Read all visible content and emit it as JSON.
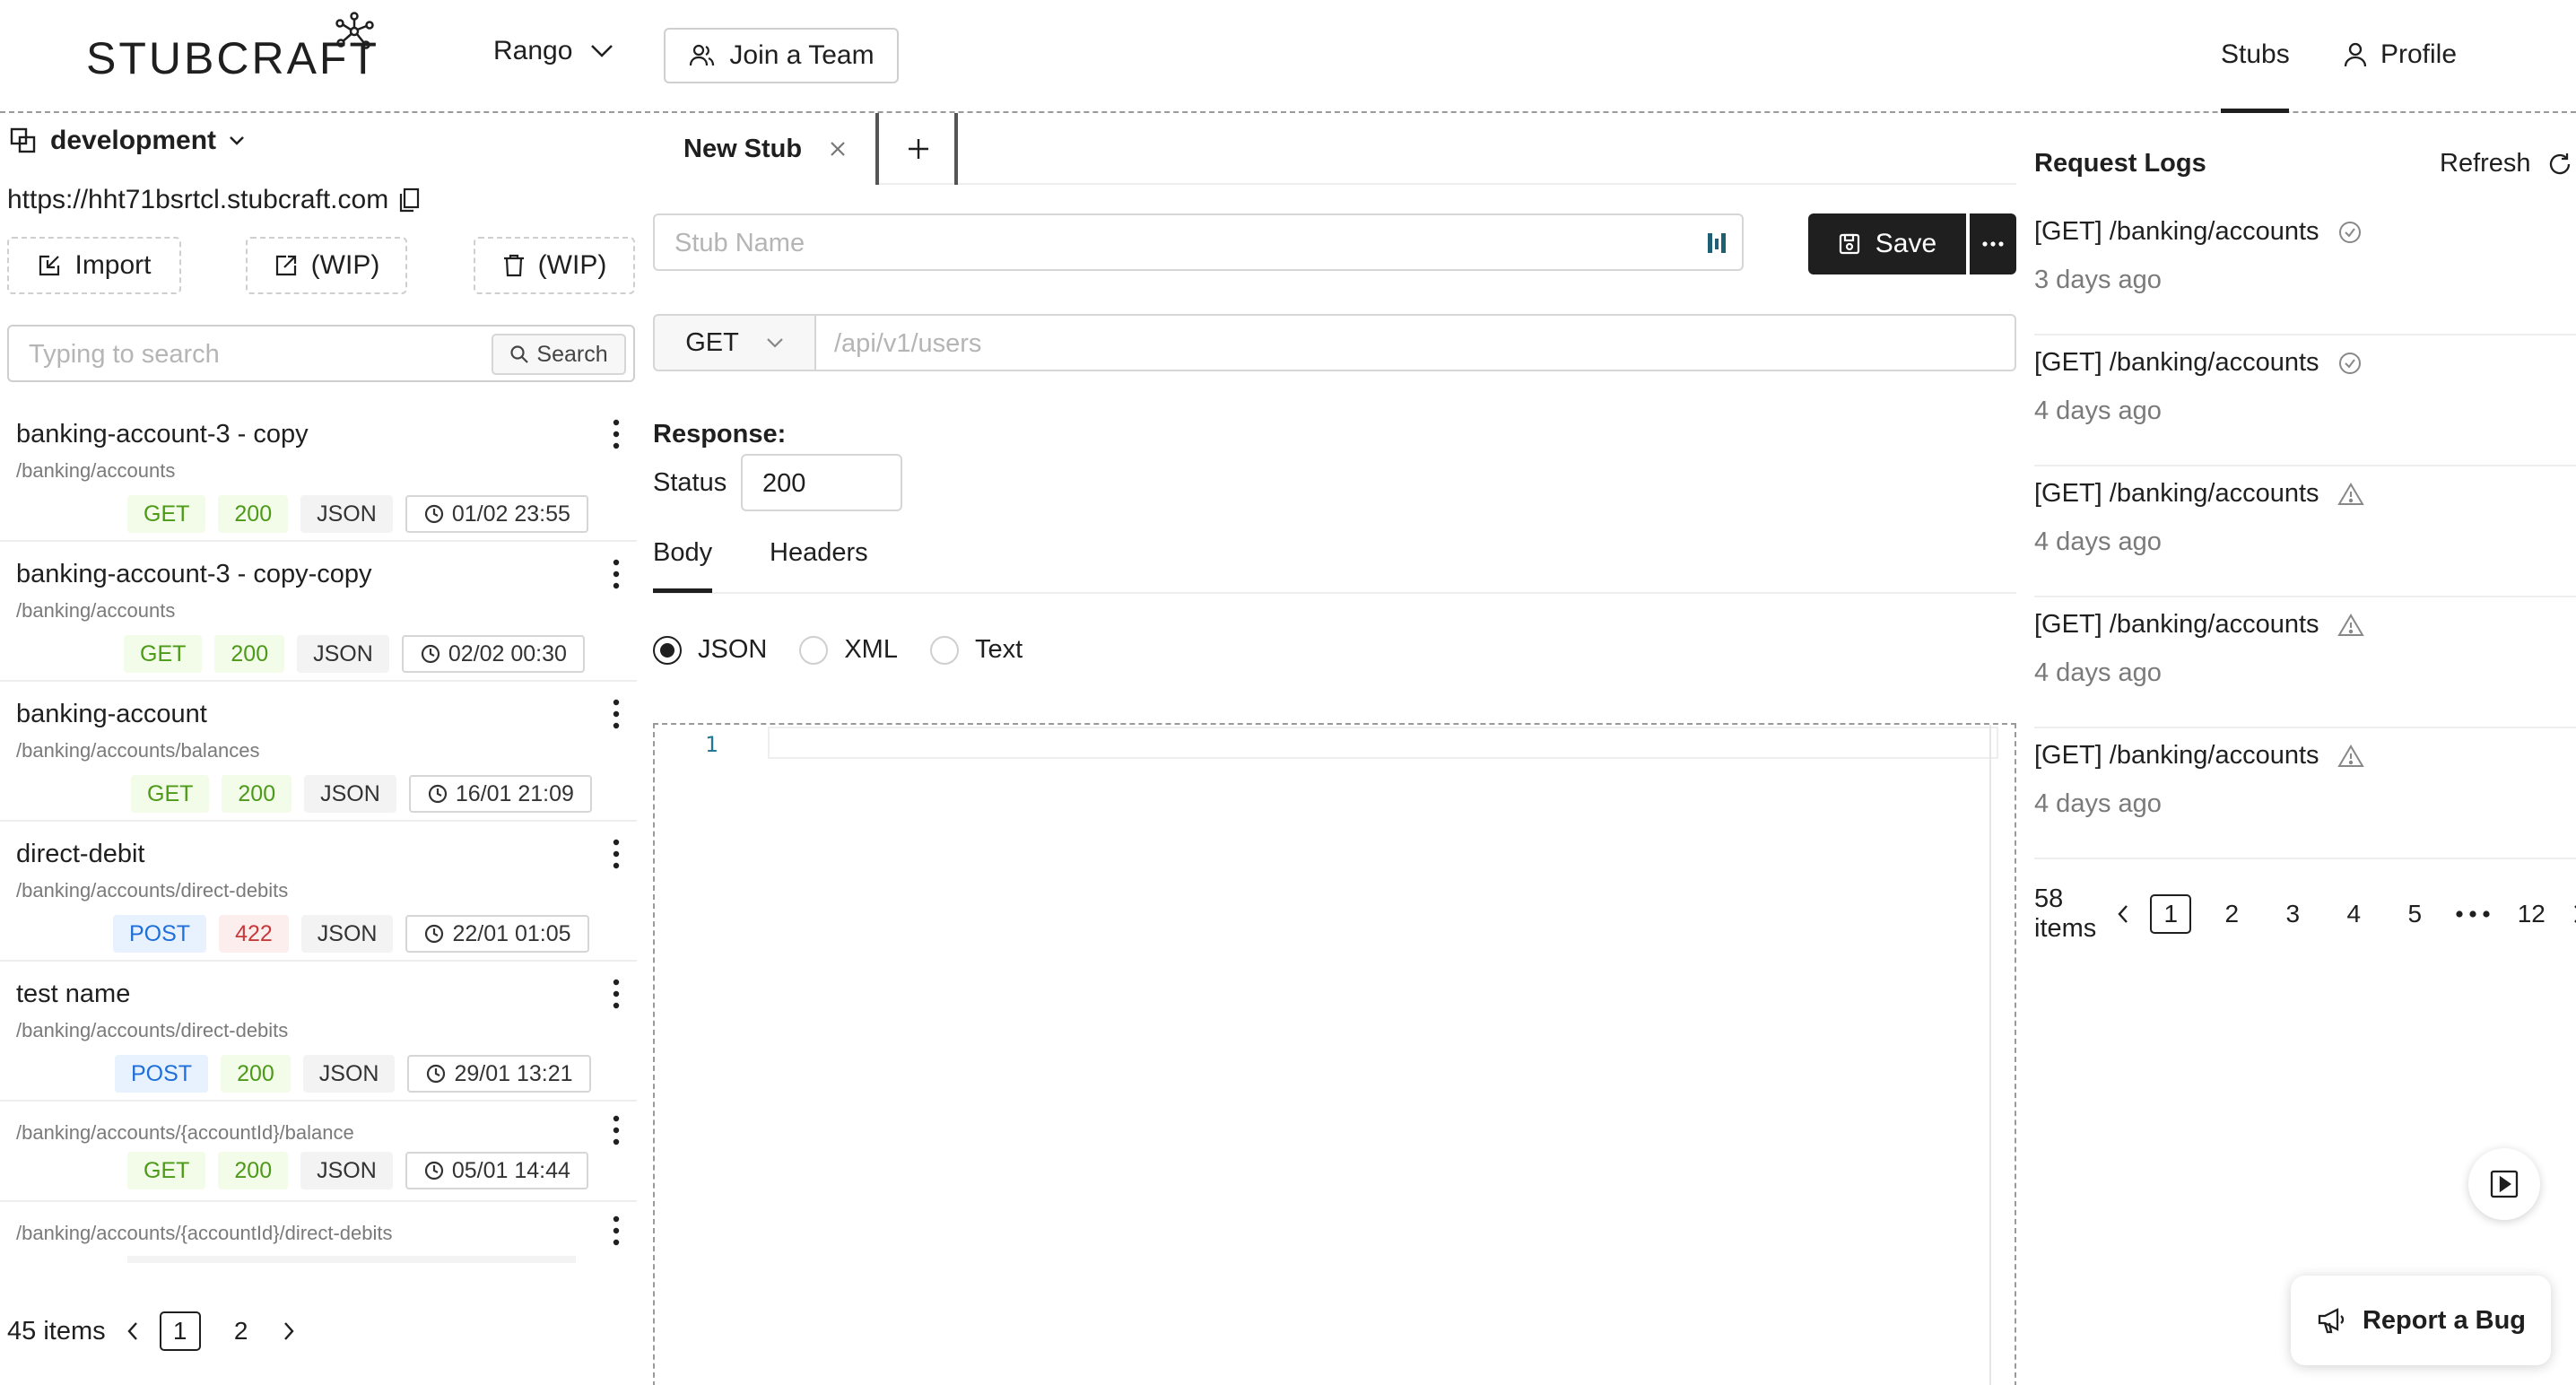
{
  "header": {
    "logo_text": "STUBCRAFT",
    "team": "Rango",
    "join_team": "Join a Team",
    "nav_stubs": "Stubs",
    "nav_profile": "Profile"
  },
  "environment": {
    "name": "development",
    "url": "https://hht71bsrtcl.stubcraft.com"
  },
  "actions": {
    "import": "Import",
    "export": "(WIP)",
    "delete": "(WIP)"
  },
  "search": {
    "placeholder": "Typing to search",
    "button": "Search"
  },
  "stubs": [
    {
      "name": "banking-account-3 - copy",
      "path": "/banking/accounts",
      "method": "GET",
      "status": "200",
      "format": "JSON",
      "time": "01/02 23:55"
    },
    {
      "name": "banking-account-3 - copy-copy",
      "path": "/banking/accounts",
      "method": "GET",
      "status": "200",
      "format": "JSON",
      "time": "02/02 00:30"
    },
    {
      "name": "banking-account",
      "path": "/banking/accounts/balances",
      "method": "GET",
      "status": "200",
      "format": "JSON",
      "time": "16/01 21:09"
    },
    {
      "name": "direct-debit",
      "path": "/banking/accounts/direct-debits",
      "method": "POST",
      "status": "422",
      "format": "JSON",
      "time": "22/01 01:05"
    },
    {
      "name": "test name",
      "path": "/banking/accounts/direct-debits",
      "method": "POST",
      "status": "200",
      "format": "JSON",
      "time": "29/01 13:21"
    },
    {
      "name": "",
      "path": "/banking/accounts/{accountId}/balance",
      "method": "GET",
      "status": "200",
      "format": "JSON",
      "time": "05/01 14:44"
    },
    {
      "name": "",
      "path": "/banking/accounts/{accountId}/direct-debits",
      "method": "",
      "status": "",
      "format": "",
      "time": ""
    }
  ],
  "left_pagination": {
    "total": "45 items",
    "pages": [
      "1",
      "2"
    ],
    "current": "1"
  },
  "editor": {
    "tab_label": "New Stub",
    "name_placeholder": "Stub Name",
    "save": "Save",
    "method": "GET",
    "path_placeholder": "/api/v1/users",
    "response_label": "Response:",
    "status_label": "Status",
    "status_value": "200",
    "tabs": [
      "Body",
      "Headers"
    ],
    "active_tab": "Body",
    "formats": [
      "JSON",
      "XML",
      "Text"
    ],
    "selected_format": "JSON",
    "line_number": "1"
  },
  "request_logs": {
    "title": "Request Logs",
    "refresh": "Refresh",
    "items": [
      {
        "title": "[GET] /banking/accounts",
        "time": "3 days ago",
        "icon": "check-circle-icon"
      },
      {
        "title": "[GET] /banking/accounts",
        "time": "4 days ago",
        "icon": "check-circle-icon"
      },
      {
        "title": "[GET] /banking/accounts",
        "time": "4 days ago",
        "icon": "warning-triangle-icon"
      },
      {
        "title": "[GET] /banking/accounts",
        "time": "4 days ago",
        "icon": "warning-triangle-icon"
      },
      {
        "title": "[GET] /banking/accounts",
        "time": "4 days ago",
        "icon": "warning-triangle-icon"
      }
    ],
    "pagination": {
      "total": "58 items",
      "pages": [
        "1",
        "2",
        "3",
        "4",
        "5",
        "12"
      ],
      "current": "1"
    }
  },
  "report_bug": "Report a Bug",
  "colors": {
    "primary": "#1f1f1f",
    "get_green": "#4c9a18",
    "post_blue": "#1e6fd9",
    "error_red": "#c83a3a"
  }
}
